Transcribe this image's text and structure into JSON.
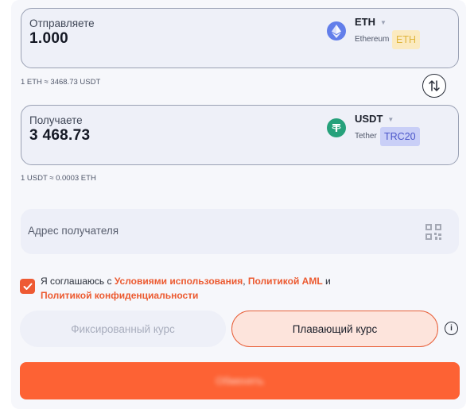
{
  "send": {
    "label": "Отправляете",
    "amount": "1.000",
    "ticker": "ETH",
    "coin_name": "Ethereum",
    "network": "ETH",
    "icon": "ethereum-icon",
    "rate": "1 ETH ≈ 3468.73 USDT"
  },
  "receive": {
    "label": "Получаете",
    "amount": "3 468.73",
    "ticker": "USDT",
    "coin_name": "Tether",
    "network": "TRC20",
    "icon": "tether-icon",
    "rate": "1 USDT ≈ 0.0003 ETH"
  },
  "address": {
    "placeholder": "Адрес получателя"
  },
  "agreement": {
    "checked": true,
    "prefix": "Я соглашаюсь с ",
    "terms_link": "Условиями использования",
    "comma": ", ",
    "aml_link": "Политикой AML",
    "and": " и ",
    "privacy_link": "Политикой конфиденциальности"
  },
  "rate_type": {
    "fixed_label": "Фиксированный курс",
    "floating_label": "Плавающий курс",
    "selected": "floating"
  },
  "submit": {
    "label": "Обменять"
  },
  "colors": {
    "accent": "#fd6234",
    "eth_icon": "#627eea",
    "usdt_icon": "#26a17b",
    "eth_badge_bg": "#fbeac0",
    "eth_badge_text": "#e0b53c",
    "trc20_badge_bg": "#c9cff7",
    "trc20_badge_text": "#4a55c9"
  }
}
